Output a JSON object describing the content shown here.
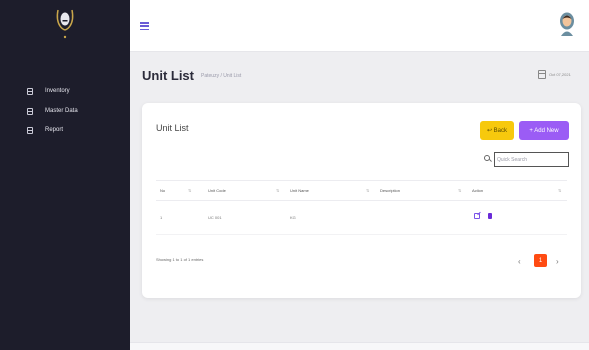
{
  "sidebar": {
    "items": [
      {
        "label": "Inventory",
        "icon": "box-icon"
      },
      {
        "label": "Master Data",
        "icon": "database-icon"
      },
      {
        "label": "Report",
        "icon": "report-icon"
      }
    ]
  },
  "header": {
    "menu_icon": "hamburger-icon",
    "avatar_icon": "user-avatar-icon"
  },
  "page": {
    "title": "Unit List",
    "breadcrumb": "Pateuzy / Unit List",
    "date": "Oct 07,2021"
  },
  "card": {
    "title": "Unit List",
    "back_label": "↩ Back",
    "add_label": "+ Add New",
    "search_placeholder": "Quick Search"
  },
  "table": {
    "columns": [
      "No",
      "Unit Code",
      "Unit Name",
      "Description",
      "Action"
    ],
    "rows": [
      {
        "no": "1",
        "code": "UC 001",
        "name": "KG",
        "description": ""
      }
    ]
  },
  "footer": {
    "entries_info": "Showing 1 to 1 of 1 entries",
    "prev": "‹",
    "current_page": "1",
    "next": "›"
  },
  "colors": {
    "sidebar_bg": "#1d1d2b",
    "accent_purple": "#9b5cf5",
    "back_yellow": "#f7c90d",
    "page_active": "#ff4b12"
  }
}
